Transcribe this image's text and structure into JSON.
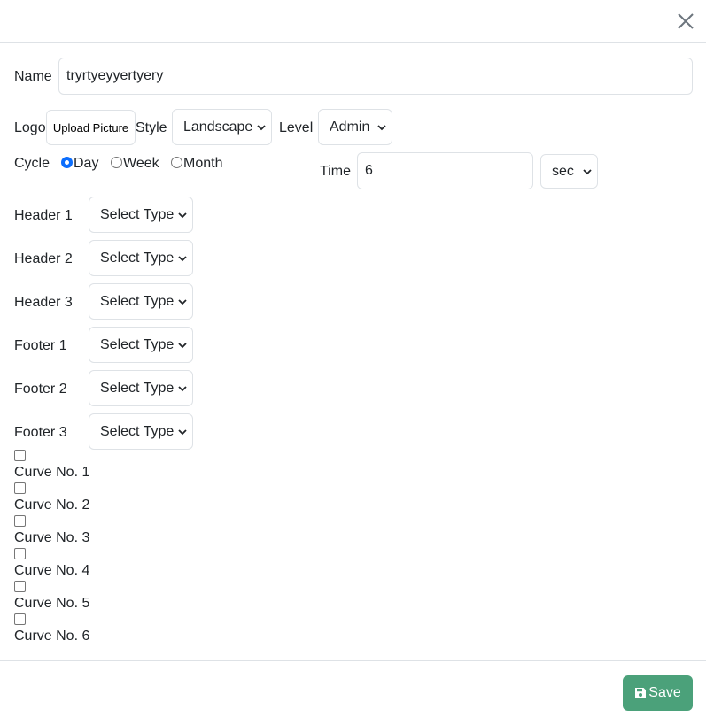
{
  "form": {
    "name_label": "Name",
    "name_value": "tryrtyeyyertyery",
    "logo_label": "Logo",
    "upload_label": "Upload Picture",
    "style_label": "Style",
    "style_value": "Landscape",
    "level_label": "Level",
    "level_value": "Admin",
    "cycle_label": "Cycle",
    "cycle_options": [
      "Day",
      "Week",
      "Month"
    ],
    "cycle_selected": "Day",
    "time_label": "Time",
    "time_value": "6",
    "time_unit": "sec",
    "type_selects": [
      {
        "label": "Header 1",
        "value": "Select Type"
      },
      {
        "label": "Header 2",
        "value": "Select Type"
      },
      {
        "label": "Header 3",
        "value": "Select Type"
      },
      {
        "label": "Footer 1",
        "value": "Select Type"
      },
      {
        "label": "Footer 2",
        "value": "Select Type"
      },
      {
        "label": "Footer 3",
        "value": "Select Type"
      }
    ],
    "curves": [
      {
        "label": "Curve No. 1",
        "checked": false
      },
      {
        "label": "Curve No. 2",
        "checked": false
      },
      {
        "label": "Curve No. 3",
        "checked": false
      },
      {
        "label": "Curve No. 4",
        "checked": false
      },
      {
        "label": "Curve No. 5",
        "checked": false
      },
      {
        "label": "Curve No. 6",
        "checked": false
      }
    ]
  },
  "footer": {
    "save_label": "Save"
  },
  "icons": {
    "close": "close-icon",
    "save": "save-icon",
    "dropdown": "chevron-down-icon"
  },
  "colors": {
    "save_button": "#4ba17a",
    "radio_checked": "#0d6efd",
    "border": "#dee2e6"
  }
}
